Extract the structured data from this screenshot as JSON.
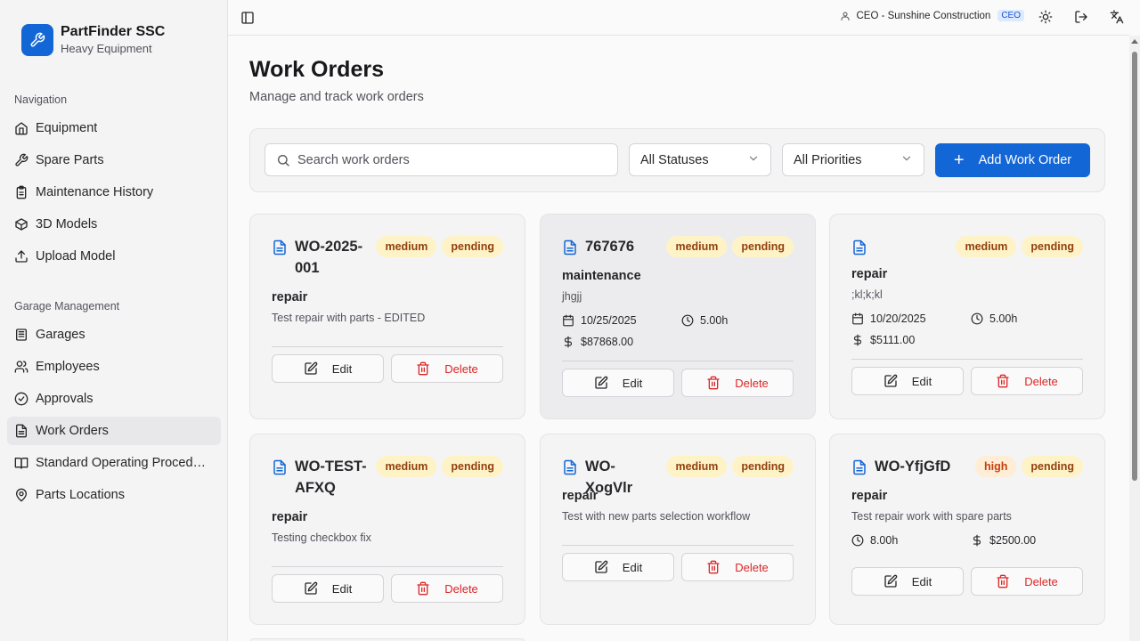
{
  "app": {
    "name": "PartFinder SSC",
    "subtitle": "Heavy Equipment"
  },
  "sidebar": {
    "groups": [
      {
        "title": "Navigation",
        "items": [
          {
            "label": "Equipment",
            "icon": "home-icon"
          },
          {
            "label": "Spare Parts",
            "icon": "wrench-icon"
          },
          {
            "label": "Maintenance History",
            "icon": "clipboard-icon"
          },
          {
            "label": "3D Models",
            "icon": "box-icon"
          },
          {
            "label": "Upload Model",
            "icon": "upload-icon"
          }
        ]
      },
      {
        "title": "Garage Management",
        "items": [
          {
            "label": "Garages",
            "icon": "building-icon"
          },
          {
            "label": "Employees",
            "icon": "users-icon"
          },
          {
            "label": "Approvals",
            "icon": "check-circle-icon"
          },
          {
            "label": "Work Orders",
            "icon": "file-icon",
            "active": true
          },
          {
            "label": "Standard Operating Procedures",
            "icon": "book-icon"
          },
          {
            "label": "Parts Locations",
            "icon": "map-pin-icon"
          }
        ]
      }
    ]
  },
  "header": {
    "user": "CEO - Sunshine Construction",
    "role": "CEO"
  },
  "page": {
    "title": "Work Orders",
    "subtitle": "Manage and track work orders"
  },
  "filters": {
    "search_placeholder": "Search work orders",
    "status": "All Statuses",
    "priority": "All Priorities",
    "add_label": "Add Work Order"
  },
  "labels": {
    "edit": "Edit",
    "delete": "Delete"
  },
  "work_orders": [
    {
      "id": "WO-2025-001",
      "priority": "medium",
      "status": "pending",
      "type": "repair",
      "description": "Test repair with parts - EDITED",
      "date": "",
      "hours": "",
      "cost": ""
    },
    {
      "id": "767676",
      "priority": "medium",
      "status": "pending",
      "type": "maintenance",
      "description": "jhgjj",
      "date": "10/25/2025",
      "hours": "5.00h",
      "cost": "$87868.00"
    },
    {
      "id": "",
      "priority": "medium",
      "status": "pending",
      "type": "repair",
      "description": ";kl;k;kl",
      "date": "10/20/2025",
      "hours": "5.00h",
      "cost": "$5111.00"
    },
    {
      "id": "WO-TEST-AFXQ",
      "priority": "medium",
      "status": "pending",
      "type": "repair",
      "description": "Testing checkbox fix",
      "date": "",
      "hours": "",
      "cost": ""
    },
    {
      "id": "WO-XogVlr",
      "priority": "medium",
      "status": "pending",
      "type": "repair",
      "description": "Test with new parts selection workflow",
      "date": "",
      "hours": "",
      "cost": ""
    },
    {
      "id": "WO-YfjGfD",
      "priority": "high",
      "status": "pending",
      "type": "repair",
      "description": "Test repair work with spare parts",
      "date": "",
      "hours": "8.00h",
      "cost": "$2500.00"
    }
  ]
}
